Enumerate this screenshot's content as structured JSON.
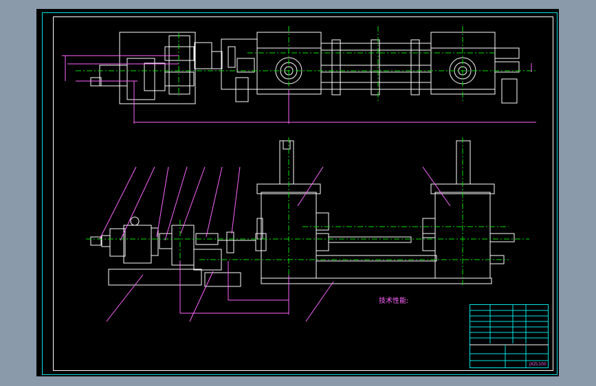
{
  "drawing": {
    "tech_heading": "技术性能:",
    "title_block": {
      "drawing_number": "JXZL100"
    }
  },
  "colors": {
    "background": "#8b9aab",
    "paper": "#000000",
    "outline": "#ffffff",
    "centerline": "#00e000",
    "dimension": "#ff66ff",
    "frame": "#00e5e5"
  }
}
